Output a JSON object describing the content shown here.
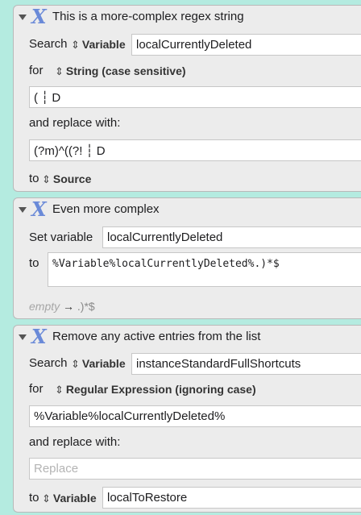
{
  "actions": [
    {
      "title": "This is a more-complex regex string",
      "search_label": "Search",
      "source_type": "Variable",
      "source_name": "localCurrentlyDeleted",
      "for_label": "for",
      "match_mode": "String (case sensitive)",
      "find_text": "( ┆ D",
      "replace_label": "and replace with:",
      "replace_text": "(?m)^((?! ┆ D",
      "to_label": "to",
      "dest_type": "Source"
    },
    {
      "title": "Even more complex",
      "set_label": "Set variable",
      "variable_name": "localCurrentlyDeleted",
      "to_label": "to",
      "value_text": "%Variable%localCurrentlyDeleted%.)*$",
      "preview_empty": "empty",
      "preview_arrow": "→",
      "preview_text": ".)*$"
    },
    {
      "title": "Remove any active entries from the list",
      "search_label": "Search",
      "source_type": "Variable",
      "source_name": "instanceStandardFullShortcuts",
      "for_label": "for",
      "match_mode": "Regular Expression (ignoring case)",
      "find_text": "%Variable%localCurrentlyDeleted%",
      "replace_label": "and replace with:",
      "replace_placeholder": "Replace",
      "to_label": "to",
      "dest_type": "Variable",
      "dest_name": "localToRestore"
    }
  ],
  "icons": {
    "updown": "⌃⌄",
    "action_icon": "X"
  }
}
